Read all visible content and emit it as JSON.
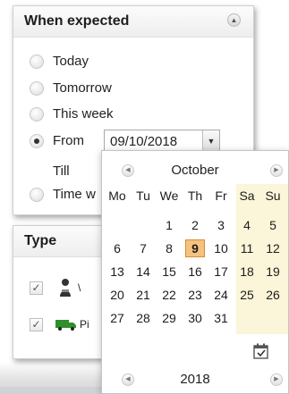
{
  "when_panel": {
    "title": "When expected",
    "options": [
      {
        "label": "Today",
        "checked": false
      },
      {
        "label": "Tomorrow",
        "checked": false
      },
      {
        "label": "This week",
        "checked": false
      },
      {
        "label": "From",
        "checked": true
      },
      {
        "label": "Time w",
        "checked": false
      }
    ],
    "till_label": "Till",
    "from_date_value": "09/10/2018"
  },
  "type_panel": {
    "title": "Type",
    "items": [
      {
        "label": "\\",
        "checked": true,
        "icon": "person-icon"
      },
      {
        "label": "Pi",
        "checked": true,
        "icon": "truck-icon"
      }
    ]
  },
  "calendar": {
    "month": "October",
    "year": "2018",
    "weekdays": [
      "Mo",
      "Tu",
      "We",
      "Th",
      "Fr",
      "Sa",
      "Su"
    ],
    "weeks": [
      [
        "",
        "",
        "1",
        "2",
        "3",
        "4",
        "5"
      ],
      [
        "6",
        "7",
        "8",
        "9",
        "10",
        "11",
        "12"
      ],
      [
        "13",
        "14",
        "15",
        "16",
        "17",
        "18",
        "19"
      ],
      [
        "20",
        "21",
        "22",
        "23",
        "24",
        "25",
        "26"
      ],
      [
        "27",
        "28",
        "29",
        "30",
        "31",
        "",
        ""
      ]
    ],
    "selected_day": "9",
    "weekend_color": "#fbf5d9",
    "selected_color": "#f5c27e"
  }
}
